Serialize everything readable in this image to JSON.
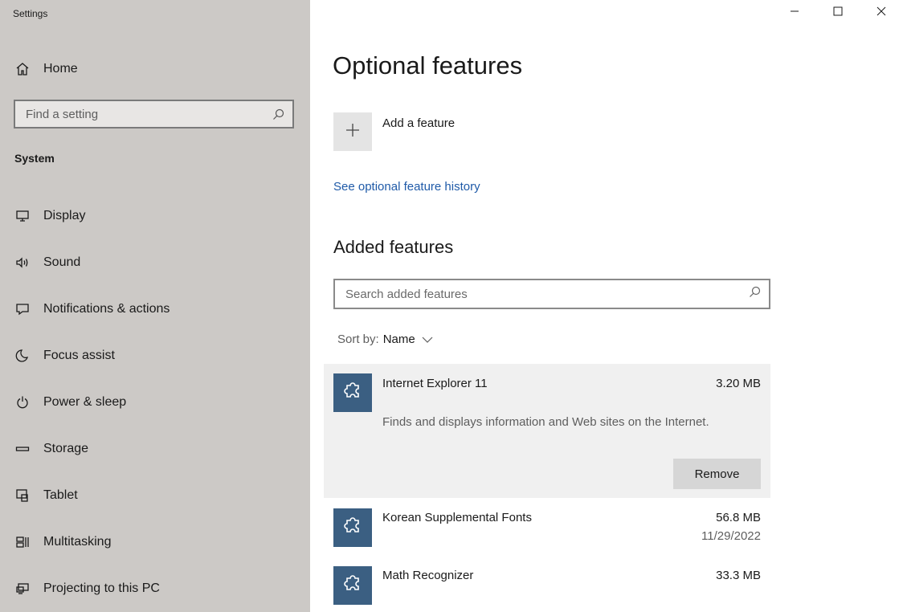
{
  "window": {
    "title": "Settings",
    "controls": {
      "minimize": "minimize-icon",
      "maximize": "maximize-icon",
      "close": "close-icon"
    }
  },
  "sidebar": {
    "home_label": "Home",
    "search_placeholder": "Find a setting",
    "section_label": "System",
    "items": [
      {
        "label": "Display",
        "icon": "display-icon"
      },
      {
        "label": "Sound",
        "icon": "sound-icon"
      },
      {
        "label": "Notifications & actions",
        "icon": "notifications-icon"
      },
      {
        "label": "Focus assist",
        "icon": "moon-icon"
      },
      {
        "label": "Power & sleep",
        "icon": "power-icon"
      },
      {
        "label": "Storage",
        "icon": "storage-icon"
      },
      {
        "label": "Tablet",
        "icon": "tablet-icon"
      },
      {
        "label": "Multitasking",
        "icon": "multitasking-icon"
      },
      {
        "label": "Projecting to this PC",
        "icon": "projecting-icon"
      }
    ]
  },
  "main": {
    "title": "Optional features",
    "add_feature_label": "Add a feature",
    "history_link": "See optional feature history",
    "added_title": "Added features",
    "search_placeholder": "Search added features",
    "sort_label": "Sort by:",
    "sort_value": "Name",
    "features": [
      {
        "name": "Internet Explorer 11",
        "size": "3.20 MB",
        "description": "Finds and displays information and Web sites on the Internet.",
        "remove_label": "Remove"
      },
      {
        "name": "Korean Supplemental Fonts",
        "size": "56.8 MB",
        "date": "11/29/2022"
      },
      {
        "name": "Math Recognizer",
        "size": "33.3 MB"
      }
    ]
  },
  "colors": {
    "sidebar_bg": "#ccc9c6",
    "accent_link": "#1f5aa8",
    "feature_tile": "#3b5f82"
  }
}
